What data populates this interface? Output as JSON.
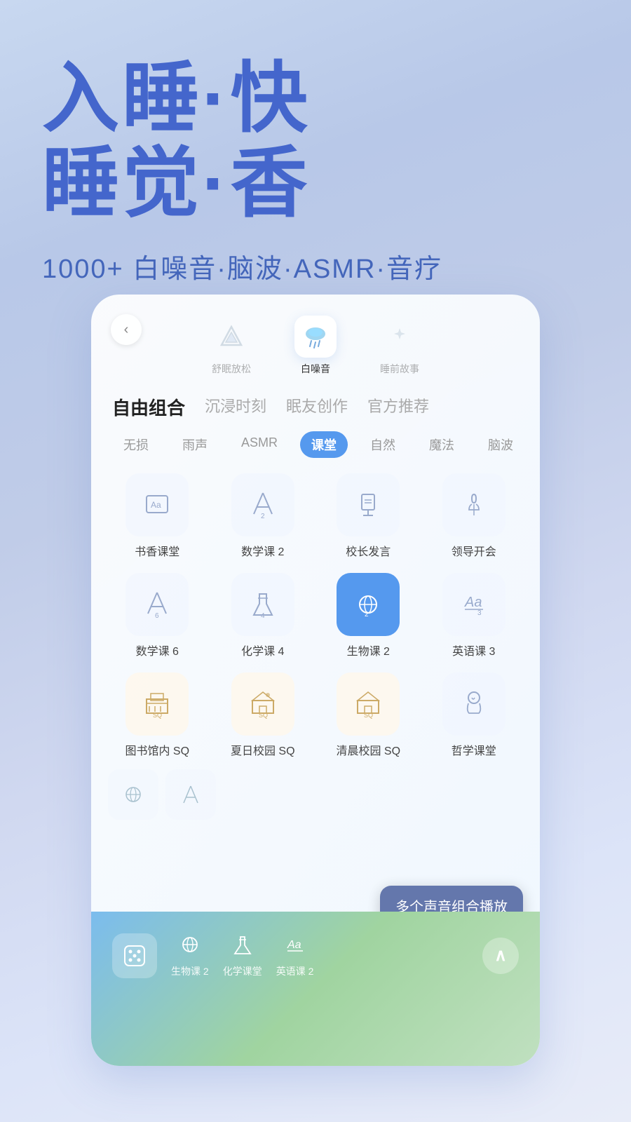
{
  "hero": {
    "title_line1": "入睡·快",
    "title_line2": "睡觉·香",
    "subtitle": "1000+ 白噪音·脑波·ASMR·音疗"
  },
  "app": {
    "back_icon": "‹",
    "tooltip": "多个声音组合播放"
  },
  "category_tabs": [
    {
      "id": "relax",
      "icon": "🏔",
      "label": "舒眠放松",
      "active": false
    },
    {
      "id": "whitenoise",
      "icon": "🌧",
      "label": "白噪音",
      "active": true
    },
    {
      "id": "bedtime",
      "icon": "✦",
      "label": "睡前故事",
      "active": false
    }
  ],
  "section_tabs": [
    {
      "id": "free",
      "label": "自由组合",
      "active": true
    },
    {
      "id": "immerse",
      "label": "沉浸时刻",
      "active": false
    },
    {
      "id": "create",
      "label": "眠友创作",
      "active": false
    },
    {
      "id": "official",
      "label": "官方推荐",
      "active": false
    }
  ],
  "filter_tags": [
    {
      "id": "lossless",
      "label": "无损",
      "active": false
    },
    {
      "id": "rain",
      "label": "雨声",
      "active": false
    },
    {
      "id": "asmr",
      "label": "ASMR",
      "active": false
    },
    {
      "id": "class",
      "label": "课堂",
      "active": true
    },
    {
      "id": "nature",
      "label": "自然",
      "active": false
    },
    {
      "id": "magic",
      "label": "魔法",
      "active": false
    },
    {
      "id": "brainwave",
      "label": "脑波",
      "active": false
    }
  ],
  "sound_grid_row1": [
    {
      "id": "book-class",
      "icon": "📚",
      "label": "书香课堂",
      "active": false,
      "type": "normal"
    },
    {
      "id": "math2",
      "icon": "📐",
      "label": "数学课 2",
      "active": false,
      "type": "normal"
    },
    {
      "id": "principal",
      "icon": "🏫",
      "label": "校长发言",
      "active": false,
      "type": "normal"
    },
    {
      "id": "meeting",
      "icon": "👔",
      "label": "领导开会",
      "active": false,
      "type": "normal"
    }
  ],
  "sound_grid_row2": [
    {
      "id": "math6",
      "icon": "📐",
      "label": "数学课 6",
      "active": false,
      "type": "normal"
    },
    {
      "id": "chem4",
      "icon": "🧪",
      "label": "化学课 4",
      "active": false,
      "type": "normal"
    },
    {
      "id": "bio2",
      "icon": "🧬",
      "label": "生物课 2",
      "active": true,
      "type": "active"
    },
    {
      "id": "english3",
      "icon": "📝",
      "label": "英语课 3",
      "active": false,
      "type": "normal"
    }
  ],
  "sound_grid_row3": [
    {
      "id": "library-sq",
      "icon": "🏛",
      "label": "图书馆内 SQ",
      "active": false,
      "type": "sq"
    },
    {
      "id": "summer-sq",
      "icon": "🏫",
      "label": "夏日校园 SQ",
      "active": false,
      "type": "sq"
    },
    {
      "id": "morning-sq",
      "icon": "🏫",
      "label": "清晨校园 SQ",
      "active": false,
      "type": "sq"
    },
    {
      "id": "philosophy",
      "icon": "🤔",
      "label": "哲学课堂",
      "active": false,
      "type": "normal"
    }
  ],
  "bottom_bar": {
    "dice_icon": "🎲",
    "tracks": [
      {
        "id": "bio2-track",
        "icon": "🧬",
        "label": "生物课 2"
      },
      {
        "id": "chem-track",
        "icon": "🧪",
        "label": "化学课堂"
      },
      {
        "id": "english2-track",
        "icon": "📝",
        "label": "英语课 2"
      }
    ],
    "expand_icon": "∧"
  },
  "partial_items": [
    {
      "id": "partial1",
      "icon": "🧬"
    },
    {
      "id": "partial2",
      "icon": "📐"
    }
  ],
  "colors": {
    "primary": "#4466cc",
    "accent": "#5599ee",
    "background_start": "#c8d8f0",
    "background_end": "#e8ecf8",
    "active_item": "#5599ee"
  }
}
